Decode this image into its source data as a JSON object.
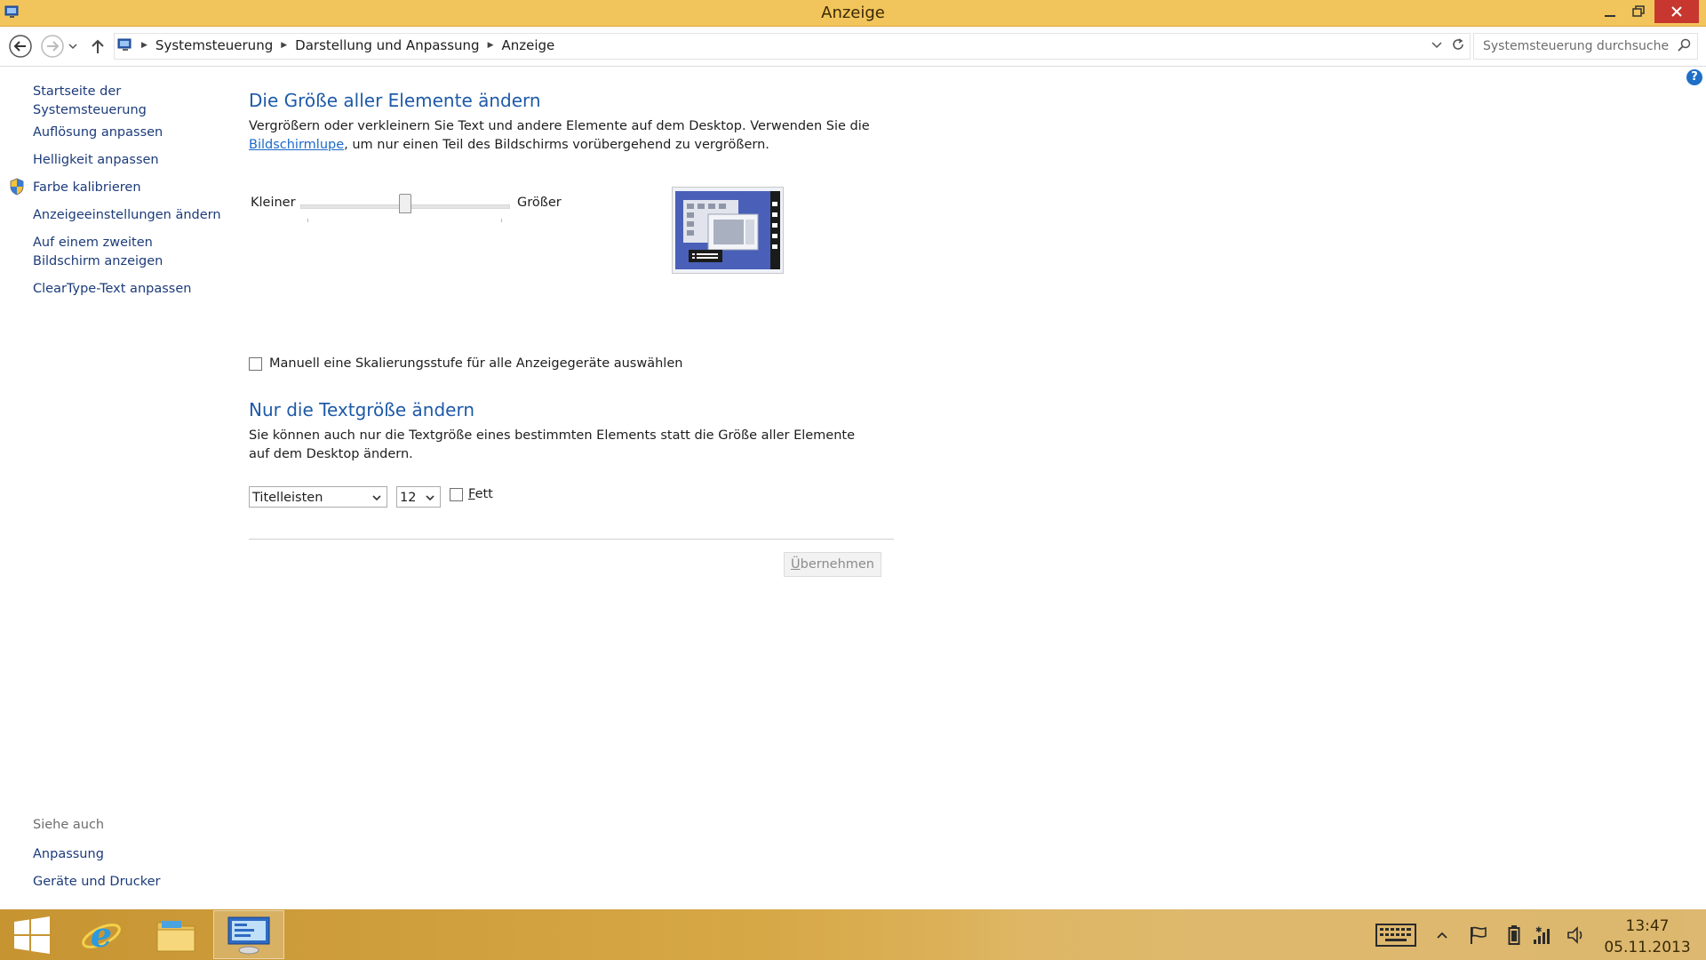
{
  "window": {
    "title": "Anzeige"
  },
  "breadcrumb": [
    "Systemsteuerung",
    "Darstellung und Anpassung",
    "Anzeige"
  ],
  "search": {
    "placeholder": "Systemsteuerung durchsuchen"
  },
  "sidebar": {
    "home": "Startseite der Systemsteuerung",
    "items": [
      "Auflösung anpassen",
      "Helligkeit anpassen",
      "Farbe kalibrieren",
      "Anzeigeeinstellungen ändern",
      "Auf einem zweiten Bildschirm anzeigen",
      "ClearType-Text anpassen"
    ],
    "see_also_title": "Siehe auch",
    "see_also": [
      "Anpassung",
      "Geräte und Drucker"
    ]
  },
  "main": {
    "heading1": "Die Größe aller Elemente ändern",
    "para1_before": "Vergrößern oder verkleinern Sie Text und andere Elemente auf dem Desktop. Verwenden Sie die ",
    "para1_link": "Bildschirmlupe",
    "para1_after": ", um nur einen Teil des Bildschirms vorübergehend zu vergrößern.",
    "slider": {
      "min_label": "Kleiner",
      "max_label": "Größer",
      "level": 0.5
    },
    "manual_checkbox_label": "Manuell eine Skalierungsstufe für alle Anzeigegeräte auswählen",
    "heading2": "Nur die Textgröße ändern",
    "para2": "Sie können auch nur die Textgröße eines bestimmten Elements statt die Größe aller Elemente auf dem Desktop ändern.",
    "element_select": "Titelleisten",
    "size_select": "12",
    "bold_label_underlined": "F",
    "bold_label_rest": "ett",
    "apply_label_underlined": "Ü",
    "apply_label_rest": "bernehmen"
  },
  "taskbar": {
    "time": "13:47",
    "date": "05.11.2013"
  },
  "colors": {
    "accent": "#f2c55c",
    "heading": "#1e5aa8",
    "link": "#1c3b7a",
    "close": "#c7372f"
  }
}
